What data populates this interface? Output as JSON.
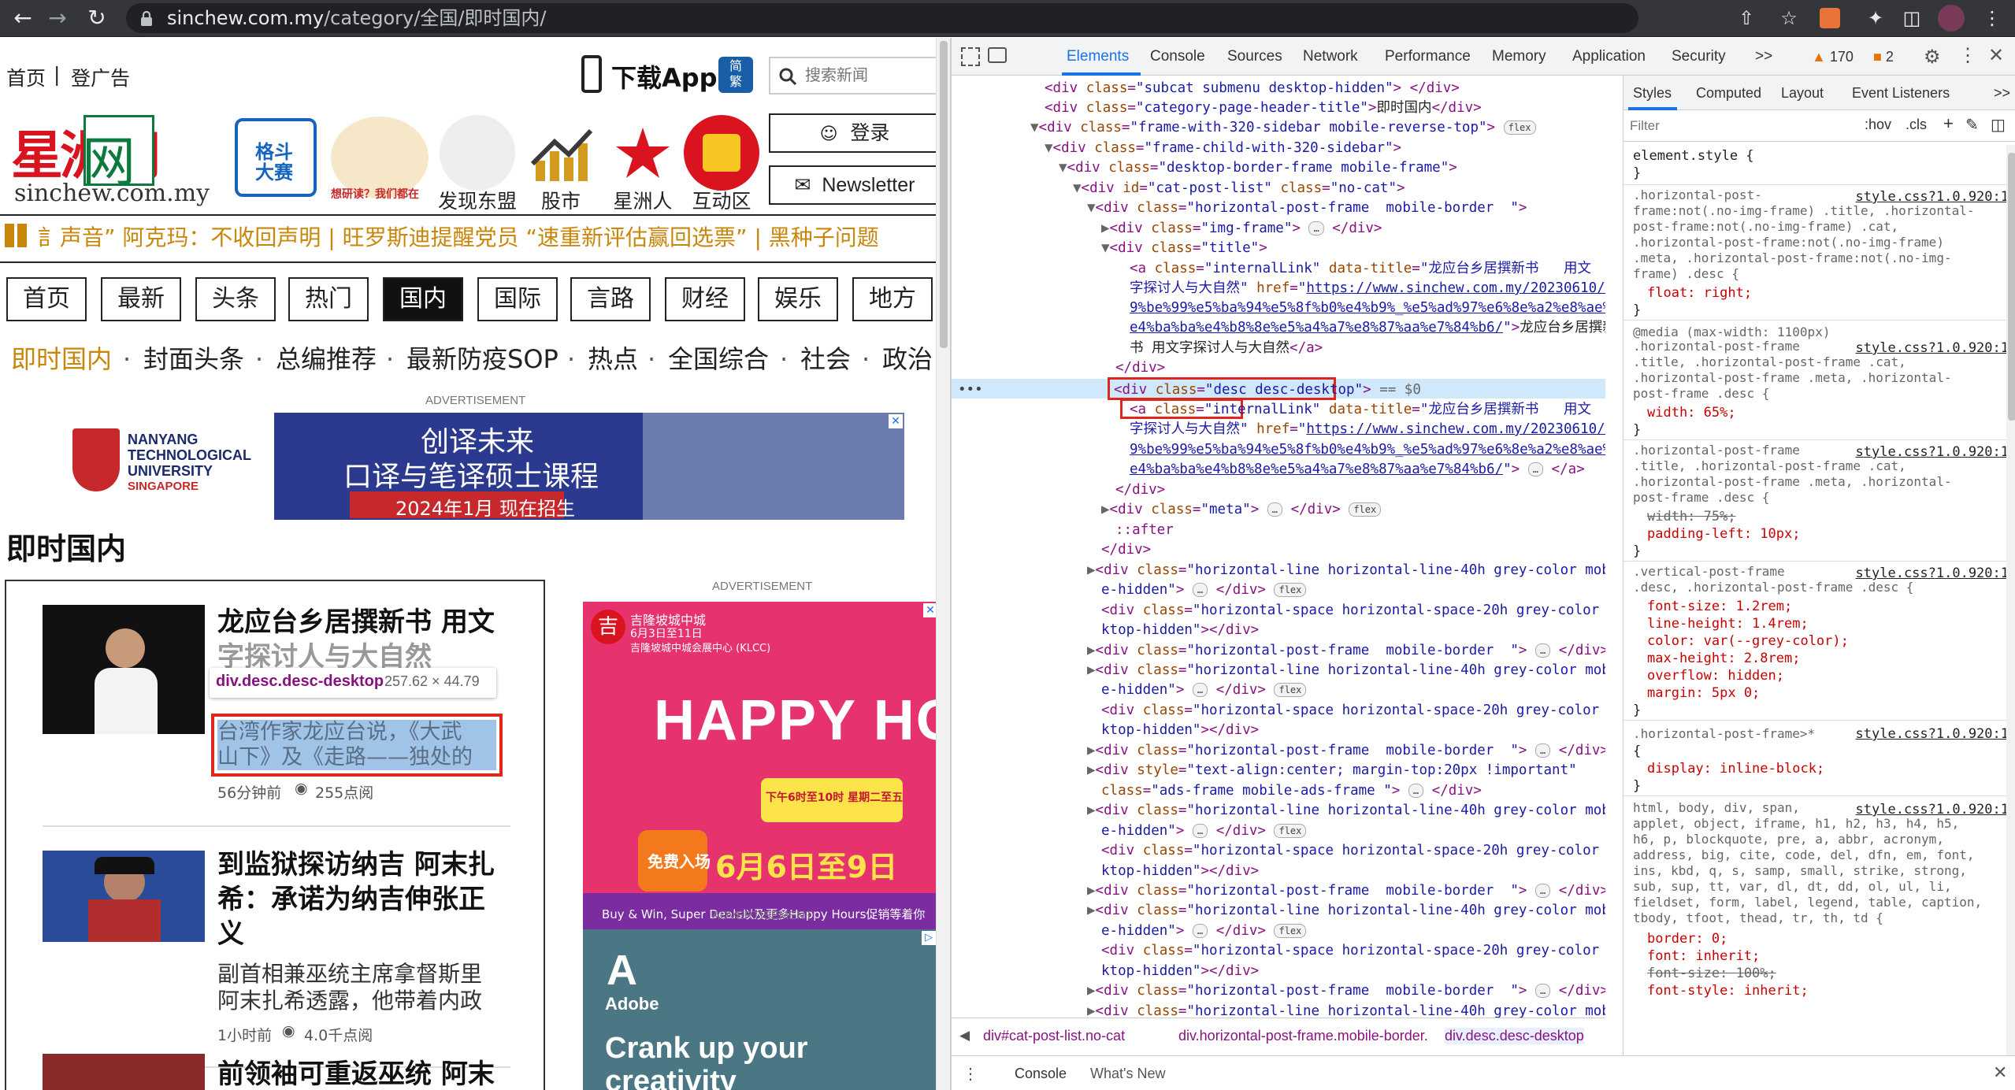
{
  "browser": {
    "url_host": "sinchew.com.my",
    "url_path": "/category/全国/即时国内/"
  },
  "site": {
    "top_links": [
      "首页",
      "|",
      "登广告"
    ],
    "download_app": "下载App",
    "traditional_chinese_badge": "简\n繁",
    "search_placeholder": "搜索新闻",
    "login_label": "登录",
    "newsletter_label": "Newsletter",
    "logo_text": "星洲网",
    "logo_sub": "sinchew.com.my",
    "icon_links": [
      "发现东盟",
      "股市",
      "星洲人",
      "互动区"
    ],
    "icon_badge_1": "格斗大赛",
    "icon_badge_2": "想研读？我们都在",
    "ticker": "訁声音”  阿克玛：不收回声明  |  旺罗斯迪提醒党员  “速重新评估赢回选票”  |  黑种子问题",
    "tabs": [
      "首页",
      "最新",
      "头条",
      "热门",
      "国内",
      "国际",
      "言路",
      "财经",
      "娱乐",
      "地方"
    ],
    "active_tab_index": 4,
    "subnav": [
      "即时国内",
      "封面头条",
      "总编推荐",
      "最新防疫SOP",
      "热点",
      "全国综合",
      "社会",
      "政治"
    ],
    "ad_label": "ADVERTISEMENT",
    "ntu_name": [
      "NANYANG",
      "TECHNOLOGICAL",
      "UNIVERSITY",
      "SINGAPORE"
    ],
    "ntu_ad_line1": "创译未来",
    "ntu_ad_line2": "口译与笔译硕士课程",
    "ntu_ad_line3": "2024年1月 现在招生",
    "section_title": "即时国内",
    "articles": [
      {
        "title_lines": [
          "龙应台乡居撰新书 用文",
          "字探讨人与大自然"
        ],
        "desc_lines": [
          "台湾作家龙应台说，《大武",
          "山下》及《走路——独处的"
        ],
        "time": "56分钟前",
        "views": "255点阅"
      },
      {
        "title_lines": [
          "到监狱探访纳吉 阿末扎",
          "希：承诺为纳吉伸张正",
          "义"
        ],
        "desc_lines": [
          "副首相兼巫统主席拿督斯里",
          "阿末扎希透露，他带着内政"
        ],
        "time": "1小时前",
        "views": "4.0千点阅"
      },
      {
        "title_lines": [
          "前领袖可重返巫统 阿末"
        ],
        "desc_lines": [],
        "time": "",
        "views": ""
      }
    ],
    "inspect_tooltip_name": "div.desc.desc-desktop",
    "inspect_tooltip_size": "257.62 × 44.79",
    "happy_hours_ad": {
      "brand": "吉隆坡城中城",
      "date_top": "6月3日至11日",
      "venue": "吉隆坡城中城会展中心 (KLCC)",
      "title": "HAPPY HOURS",
      "tag": "下午6时至10时 星期二至五",
      "free": "免费入场",
      "dates": "6月6日至9日",
      "footer": "Buy & Win, Super Deals以及更多Happy Hours促销等着你"
    },
    "adobe_ad": {
      "brand": "Adobe",
      "headline": "Crank up your",
      "headline2": "creativity"
    }
  },
  "devtools": {
    "tabs": [
      "Elements",
      "Console",
      "Sources",
      "Network",
      "Performance",
      "Memory",
      "Application",
      "Security",
      ">>"
    ],
    "active_tab": "Elements",
    "warnings": "170",
    "errors": "2",
    "style_tabs": [
      "Styles",
      "Computed",
      "Layout",
      "Event Listeners",
      ">>"
    ],
    "filter_placeholder": "Filter",
    "filter_hov": ":hov",
    "filter_cls": ".cls",
    "breadcrumb": [
      "div#cat-post-list.no-cat",
      "div.horizontal-post-frame.mobile-border.",
      "div.desc.desc-desktop"
    ],
    "drawer_tabs": [
      "Console",
      "What's New"
    ],
    "dom_lines": [
      "<div class=\"subcat submenu desktop-hidden\"> </div>",
      "<div class=\"category-page-header-title\">即时国内</div>",
      "▼<div class=\"frame-with-320-sidebar mobile-reverse-top\"> flex",
      "▼<div class=\"frame-child-with-320-sidebar\">",
      "▼<div class=\"desktop-border-frame mobile-frame\">",
      "▼<div id=\"cat-post-list\" class=\"no-cat\">",
      "▼<div class=\"horizontal-post-frame  mobile-border  \">",
      "▶<div class=\"img-frame\"> … </div>",
      "▼<div class=\"title\">",
      "<a class=\"internalLink\" data-title=\"龙应台乡居撰新书 用文字探讨人与大自然\" href=\"https://www.sinchew.com.my/20230610/%e9%be%99%e5%ba%94%e5%8f%b0%e4%b9%a1%e5%b1%85%e6%92%b0%e6%96%b0%e4%b9%a6-%e7%94%a8%e6%96%87%e5%ad%97%e6%8e%a2%e8%ae%a8%e4%ba%ba%e4%b8%8e%e5%a4%a7%e8%87%aa%e7%84%b6/\">龙应台乡居撰新书 用文字探讨人与大自然</a>",
      "</div>",
      "<div class=\"desc desc-desktop\"> == $0",
      "<a class=\"internalLink\" data-title=\"龙应台乡居撰新书 用文字探讨人与大自然\" href=\"https://www.sinchew.com.my/20230610/%e9%be%99%e5%ba%94%e5%8f%b0...\"> … </a>",
      "</div>",
      "▶<div class=\"meta\"> … </div> flex",
      "::after",
      "</div>"
    ],
    "styles": [
      "element.style {",
      "}",
      ".horizontal-post-frame:not(.no-img-frame) .title, .horizontal-post-frame:not(.no-img-frame) .cat, .horizontal-post-frame:not(.no-img-frame) .meta, .horizontal-post-frame:not(.no-img-frame) .desc {",
      "float: right;",
      "@media (max-width: 1100px)",
      "width: 65%;",
      "width: 75%;",
      "padding-left: 10px;",
      "font-size: 1.2rem;",
      "line-height: 1.4rem;",
      "color: var(--grey-color);",
      "max-height: 2.8rem;",
      "overflow: hidden;",
      "margin: 5px 0;",
      "display: inline-block;",
      "border: 0;",
      "font: inherit;",
      "font-size: 100%;",
      "font-style: inherit;"
    ],
    "style_source": "style.css?1.0.920:1"
  }
}
